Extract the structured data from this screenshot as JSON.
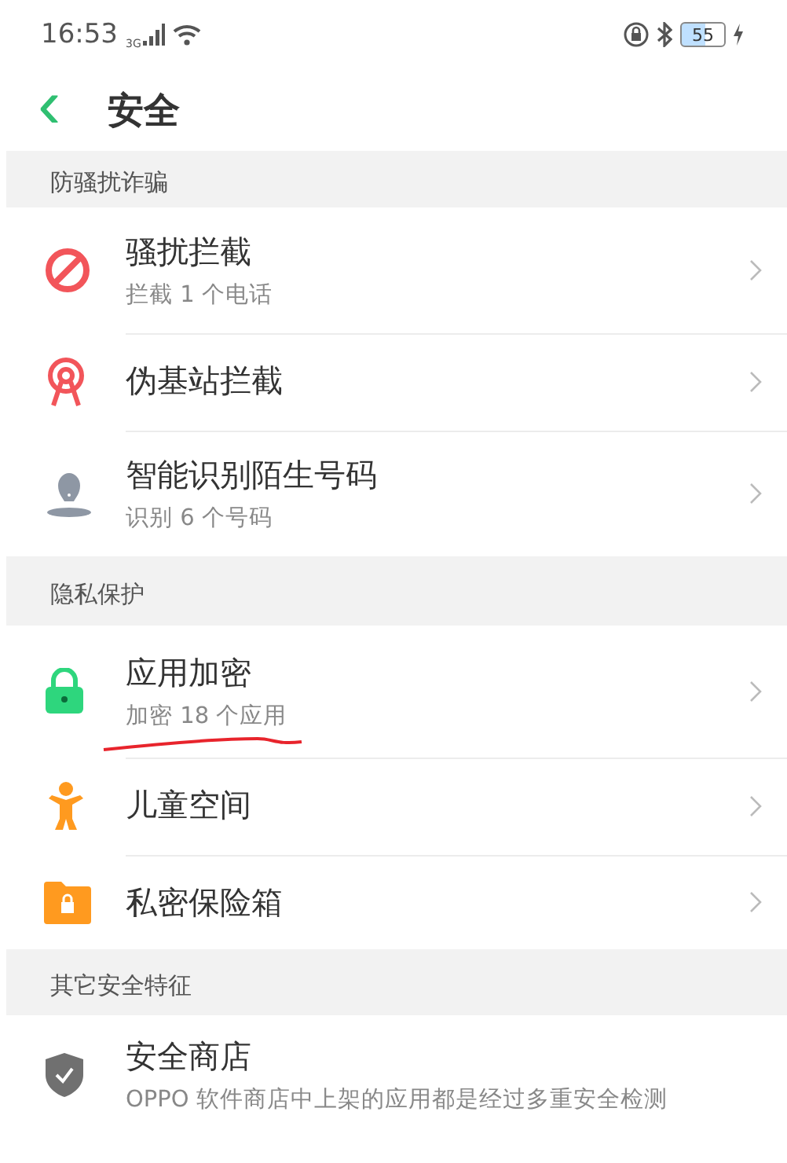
{
  "status_bar": {
    "time": "16:53",
    "network": "3G",
    "battery": "55"
  },
  "header": {
    "back": "‹",
    "title": "安全"
  },
  "sections": [
    {
      "title": "防骚扰诈骗",
      "items": [
        {
          "title": "骚扰拦截",
          "subtitle": "拦截 1 个电话",
          "annotated": false,
          "chevron": true
        },
        {
          "title": "伪基站拦截",
          "annotated": false,
          "chevron": true
        },
        {
          "title": "智能识别陌生号码",
          "subtitle": "识别 6 个号码",
          "annotated": false,
          "chevron": true
        }
      ]
    },
    {
      "title": "隐私保护",
      "items": [
        {
          "title": "应用加密",
          "subtitle": "加密 18 个应用",
          "annotated": true,
          "chevron": true
        },
        {
          "title": "儿童空间",
          "annotated": false,
          "chevron": true
        },
        {
          "title": "私密保险箱",
          "annotated": false,
          "chevron": true
        }
      ]
    },
    {
      "title": "其它安全特征",
      "items": [
        {
          "title": "安全商店",
          "subtitle": "OPPO 软件商店中上架的应用都是经过多重安全检测",
          "annotated": false,
          "chevron": false
        }
      ]
    }
  ]
}
